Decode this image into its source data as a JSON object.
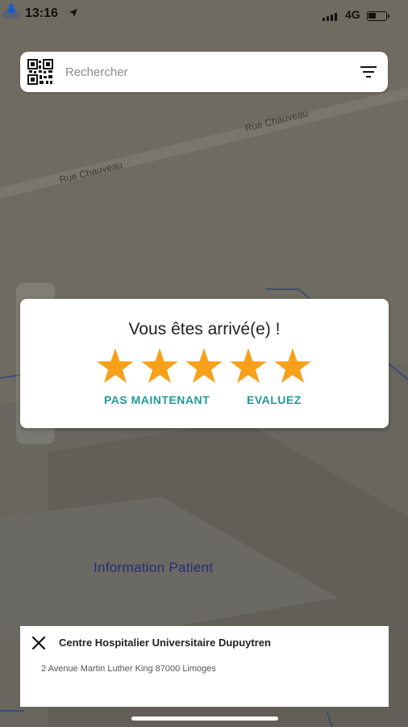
{
  "status_bar": {
    "time": "13:16",
    "network": "4G"
  },
  "search": {
    "placeholder": "Rechercher",
    "value": ""
  },
  "map": {
    "street_labels": [
      "Rue Chauveau",
      "Rue Chauveau"
    ],
    "poi_label": "Information Patient"
  },
  "rating_dialog": {
    "title": "Vous êtes arrivé(e) !",
    "star_count": 5,
    "later_label": "PAS MAINTENANT",
    "rate_label": "EVALUEZ"
  },
  "place": {
    "name": "Centre Hospitalier Universitaire Dupuytren",
    "address": "2 Avenue Martin Luther King 87000 Limoges"
  },
  "colors": {
    "star": "#f7a11a",
    "action_text": "#1d9a98",
    "poi_text": "#2c2a74",
    "map_overlay": "#6e6a60"
  },
  "icons": {
    "search_left": "qr-code-icon",
    "search_right": "filter-icon",
    "sheet_close": "close-icon",
    "status_location": "location-arrow-icon",
    "map_marker": "user-location-icon"
  }
}
